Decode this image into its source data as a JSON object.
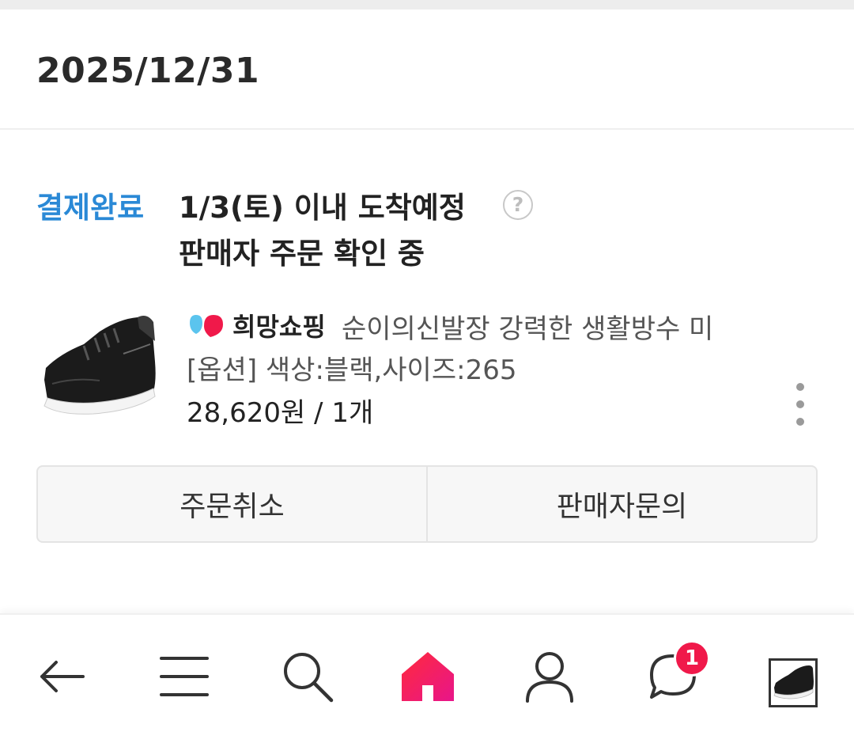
{
  "order": {
    "date": "2025/12/31",
    "status": "결제완료",
    "delivery_estimate": "1/3(토) 이내 도착예정",
    "seller_status": "판매자 주문 확인 중",
    "help_icon": "?"
  },
  "product": {
    "seller_name": "희망쇼핑",
    "name": "순이의신발장 강력한 생활방수 미",
    "option": "[옵션] 색상:블랙,사이즈:265",
    "price": "28,620원 / 1개"
  },
  "actions": {
    "cancel_label": "주문취소",
    "contact_label": "판매자문의"
  },
  "bottom_nav": {
    "items": [
      "back-icon",
      "menu-icon",
      "search-icon",
      "home-icon",
      "profile-icon",
      "chat-icon",
      "recent-product-thumbnail"
    ],
    "chat_badge": "1",
    "accent_color": "#f0194a"
  },
  "colors": {
    "status_blue": "#2a89d6",
    "logo_blue": "#5bc4ee",
    "logo_red": "#f0194a"
  }
}
